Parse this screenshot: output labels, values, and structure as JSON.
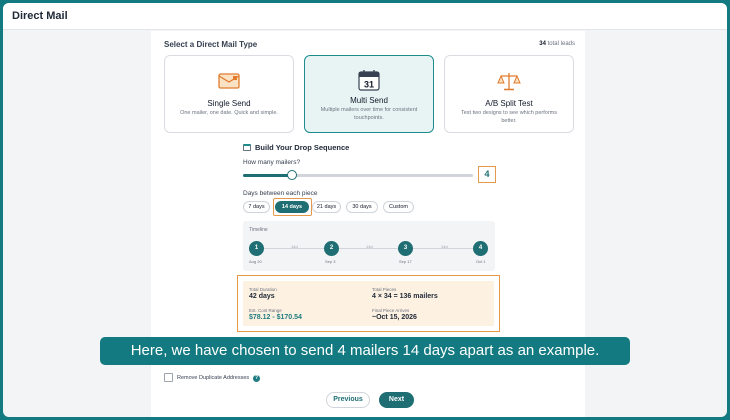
{
  "app": {
    "title": "Direct Mail"
  },
  "mail_type": {
    "heading": "Select a Direct Mail Type",
    "lead_count": "34",
    "lead_suffix": " total leads",
    "cards": [
      {
        "title": "Single Send",
        "desc": "One mailer, one date. Quick and simple.",
        "icon": "envelope-icon",
        "selected": false
      },
      {
        "title": "Multi Send",
        "desc": "Multiple mailers over time for consistent touchpoints.",
        "icon": "calendar-icon",
        "calendar_day": "31",
        "selected": true
      },
      {
        "title": "A/B Split Test",
        "desc": "Test two designs to see which performs better.",
        "icon": "scale-icon",
        "selected": false
      }
    ]
  },
  "sequence": {
    "title": "Build Your Drop Sequence",
    "mailers_question": "How many mailers?",
    "mailers_count": "4",
    "days_question": "Days between each piece",
    "day_options": [
      "7 days",
      "14 days",
      "21 days",
      "30 days",
      "Custom"
    ],
    "selected_day_option": "14 days",
    "timeline": {
      "label": "Timeline",
      "nodes": [
        "1",
        "2",
        "3",
        "4"
      ],
      "dates": [
        "Aug 20",
        "Sep 3",
        "Sep 17",
        "Oct 1"
      ],
      "gaps": [
        "14d",
        "14d",
        "14d"
      ]
    }
  },
  "summary": {
    "duration_label": "Total Duration",
    "duration_value": "42 days",
    "pieces_label": "Total Pieces",
    "pieces_value": "4 × 34 = 136 mailers",
    "cost_label": "Est. Cost Range",
    "cost_value": "$78.12 - $170.54",
    "final_label": "Final Piece Arrives",
    "final_value": "~Oct 15, 2026"
  },
  "caption": "Here, we have chosen to send 4 mailers 14 days apart as an example.",
  "options": {
    "remove_duplicates_label": "Remove Duplicate Addresses",
    "remove_duplicates_checked": false
  },
  "nav": {
    "previous_label": "Previous",
    "next_label": "Next"
  },
  "colors": {
    "brand_teal": "#1e6e73",
    "highlight_orange": "#e49a4a",
    "frame_teal": "#127a80"
  }
}
